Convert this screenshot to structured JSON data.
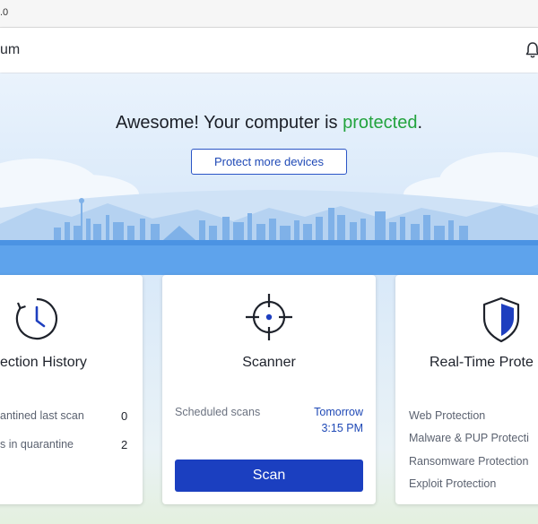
{
  "window": {
    "version_fragment": ".0"
  },
  "app_header": {
    "brand_fragment": "um"
  },
  "hero": {
    "headline_prefix": "Awesome! Your computer is ",
    "headline_accent": "protected",
    "headline_suffix": ".",
    "protect_button_label": "Protect more devices"
  },
  "cards": {
    "history": {
      "title": "ection History",
      "rows": [
        {
          "label": "antined last scan",
          "value": "0"
        },
        {
          "label": "s in quarantine",
          "value": "2"
        }
      ]
    },
    "scanner": {
      "title": "Scanner",
      "scheduled_label": "Scheduled scans",
      "scheduled_day": "Tomorrow",
      "scheduled_time": "3:15 PM",
      "scan_button_label": "Scan"
    },
    "realtime": {
      "title": "Real-Time Prote",
      "items": [
        "Web Protection",
        "Malware & PUP Protecti",
        "Ransomware Protection",
        "Exploit Protection"
      ]
    }
  },
  "colors": {
    "accent_green": "#22a33d",
    "brand_blue": "#1b3fc0",
    "link_blue": "#1f49b6"
  },
  "icons": [
    "bell-icon",
    "clock-icon",
    "crosshair-icon",
    "shield-icon"
  ]
}
